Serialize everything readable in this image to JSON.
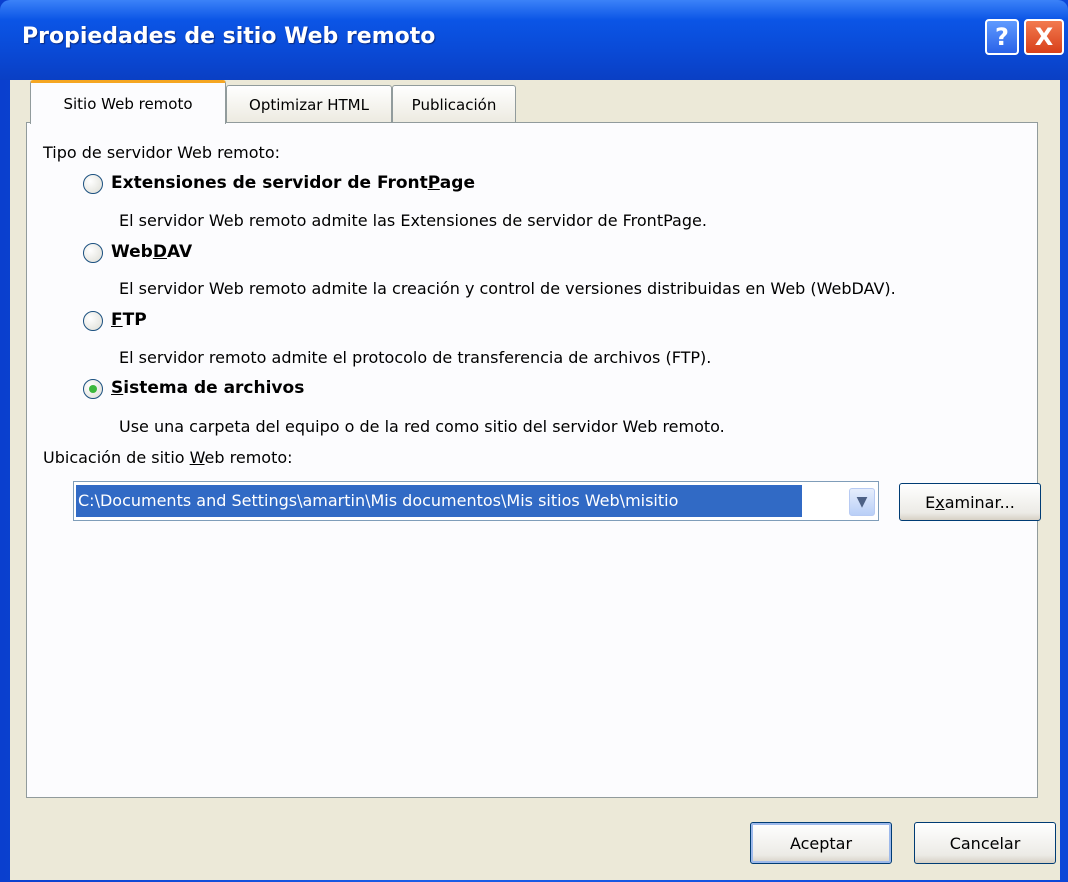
{
  "window": {
    "title": "Propiedades de sitio Web remoto",
    "help_label": "?",
    "close_label": "X"
  },
  "tabs": [
    {
      "label": "Sitio Web remoto",
      "active": true
    },
    {
      "label": "Optimizar HTML",
      "active": false
    },
    {
      "label": "Publicación",
      "active": false
    }
  ],
  "server_type": {
    "heading": "Tipo de servidor Web remoto:",
    "options": [
      {
        "title_pre": "Extensiones de servidor de Front",
        "title_key": "P",
        "title_post": "age",
        "description": "El servidor Web remoto admite las Extensiones de servidor de FrontPage.",
        "checked": false
      },
      {
        "title_pre": "Web",
        "title_key": "D",
        "title_post": "AV",
        "description": "El servidor Web remoto admite la creación y control de versiones distribuidas en Web (WebDAV).",
        "checked": false
      },
      {
        "title_pre": "",
        "title_key": "F",
        "title_post": "TP",
        "description": "El servidor remoto admite el protocolo de transferencia de archivos (FTP).",
        "checked": false
      },
      {
        "title_pre": "",
        "title_key": "S",
        "title_post": "istema de archivos",
        "description": "Use una carpeta del equipo o de la red como sitio del servidor Web remoto.",
        "checked": true
      }
    ]
  },
  "location": {
    "label_pre": "Ubicación de sitio ",
    "label_key": "W",
    "label_post": "eb remoto:",
    "value": "C:\\Documents and Settings\\amartin\\Mis documentos\\Mis sitios Web\\misitio",
    "browse_pre": "E",
    "browse_key": "x",
    "browse_post": "aminar..."
  },
  "buttons": {
    "ok": "Aceptar",
    "cancel": "Cancelar"
  }
}
